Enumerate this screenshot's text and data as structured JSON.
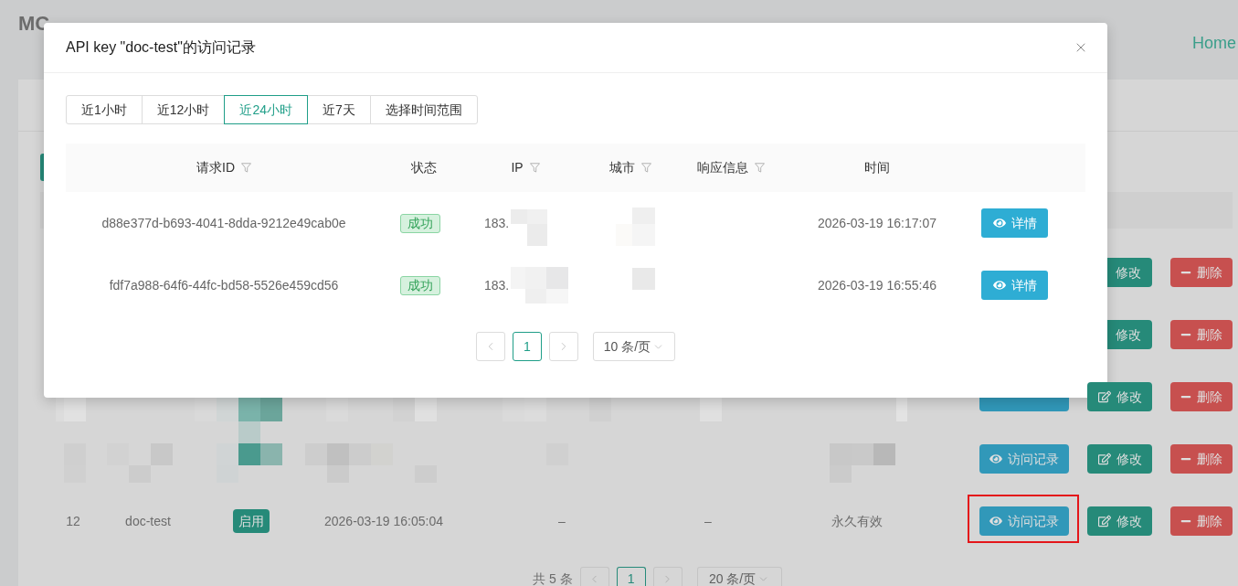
{
  "page": {
    "title": "MC",
    "nav_link": "Home"
  },
  "background_table": {
    "rows": [
      {
        "kind": "under_modal",
        "actions": [
          {
            "kind": "edit",
            "label": "修改",
            "highlighted": false
          },
          {
            "kind": "delete",
            "label": "删除",
            "highlighted": false
          }
        ]
      },
      {
        "kind": "under_modal",
        "actions": [
          {
            "kind": "edit",
            "label": "修改",
            "highlighted": false
          },
          {
            "kind": "delete",
            "label": "删除",
            "highlighted": false
          }
        ]
      },
      {
        "kind": "partly_under_modal",
        "actions": [
          {
            "kind": "covered",
            "highlighted": false
          },
          {
            "kind": "edit",
            "label": "修改",
            "highlighted": false
          },
          {
            "kind": "delete",
            "label": "删除",
            "highlighted": false
          }
        ]
      },
      {
        "kind": "redacted",
        "actions": [
          {
            "kind": "view",
            "label": "访问记录",
            "highlighted": false
          },
          {
            "kind": "edit",
            "label": "修改",
            "highlighted": false
          },
          {
            "kind": "delete",
            "label": "删除",
            "highlighted": false
          }
        ]
      },
      {
        "kind": "plain",
        "id": "12",
        "name": "doc-test",
        "status": "启用",
        "created": "2026-03-19 16:05:04",
        "column_5": "–",
        "column_6": "–",
        "expiry": "永久有效",
        "actions": [
          {
            "kind": "view",
            "label": "访问记录",
            "highlighted": true
          },
          {
            "kind": "edit",
            "label": "修改",
            "highlighted": false
          },
          {
            "kind": "delete",
            "label": "删除",
            "highlighted": false
          }
        ]
      }
    ]
  },
  "pagination": {
    "total": "共 5 条",
    "pages": [
      {
        "label": "1",
        "selected": true
      }
    ],
    "page_size": "20 条/页"
  },
  "modal": {
    "title": "API key \"doc-test\"的访问记录",
    "time_ranges": [
      {
        "label": "近1小时",
        "selected": false
      },
      {
        "label": "近12小时",
        "selected": false
      },
      {
        "label": "近24小时",
        "selected": true
      },
      {
        "label": "近7天",
        "selected": false
      },
      {
        "label": "选择时间范围",
        "selected": false
      }
    ],
    "table": {
      "columns": [
        {
          "label": "请求ID",
          "filter": true
        },
        {
          "label": "状态",
          "filter": false
        },
        {
          "label": "IP",
          "filter": true
        },
        {
          "label": "城市",
          "filter": true
        },
        {
          "label": "响应信息",
          "filter": true
        },
        {
          "label": "时间",
          "filter": false
        }
      ],
      "rows": [
        {
          "request_id": "d88e377d-b693-4041-8dda-9212e49cab0e",
          "status": "成功",
          "ip": {
            "text": "183.",
            "redacted": true
          },
          "city": {
            "redacted": true
          },
          "time": "2026-03-19 16:17:07",
          "action": "详情"
        },
        {
          "request_id": "fdf7a988-64f6-44fc-bd58-5526e459cd56",
          "status": "成功",
          "ip": {
            "text": "183.",
            "redacted": true
          },
          "city": {
            "redacted": true
          },
          "time": "2026-03-19 16:55:46",
          "action": "详情"
        }
      ]
    },
    "pagination": {
      "pages": [
        {
          "label": "1",
          "selected": true
        }
      ],
      "page_size": "10 条/页"
    }
  }
}
